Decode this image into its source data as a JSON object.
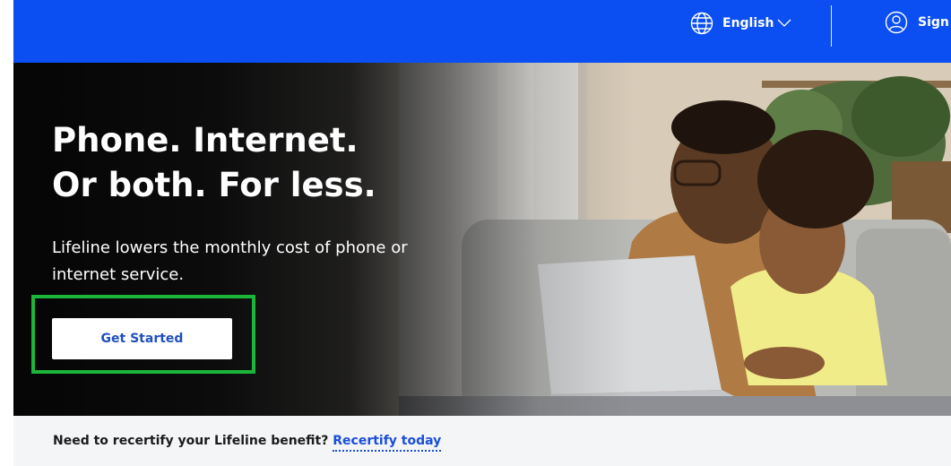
{
  "header": {
    "language_label": "English",
    "signin_label": "Sign in",
    "colors": {
      "background": "#0b4ef2",
      "text": "#ffffff"
    }
  },
  "hero": {
    "title_line1": "Phone. Internet.",
    "title_line2": "Or both. For less.",
    "subtitle": "Lifeline lowers the monthly cost of phone or internet service.",
    "cta_label": "Get Started",
    "image_alt": "Father and young child using a laptop on a couch",
    "colors": {
      "cta_text": "#1f4fbf",
      "highlight": "#1bb53a"
    }
  },
  "notice": {
    "text": "Need to recertify your Lifeline benefit?",
    "link_label": "Recertify today",
    "colors": {
      "link": "#1a4ed8"
    }
  },
  "icons": {
    "language": "globe-icon",
    "language_dropdown": "chevron-down-icon",
    "signin": "user-circle-icon"
  }
}
